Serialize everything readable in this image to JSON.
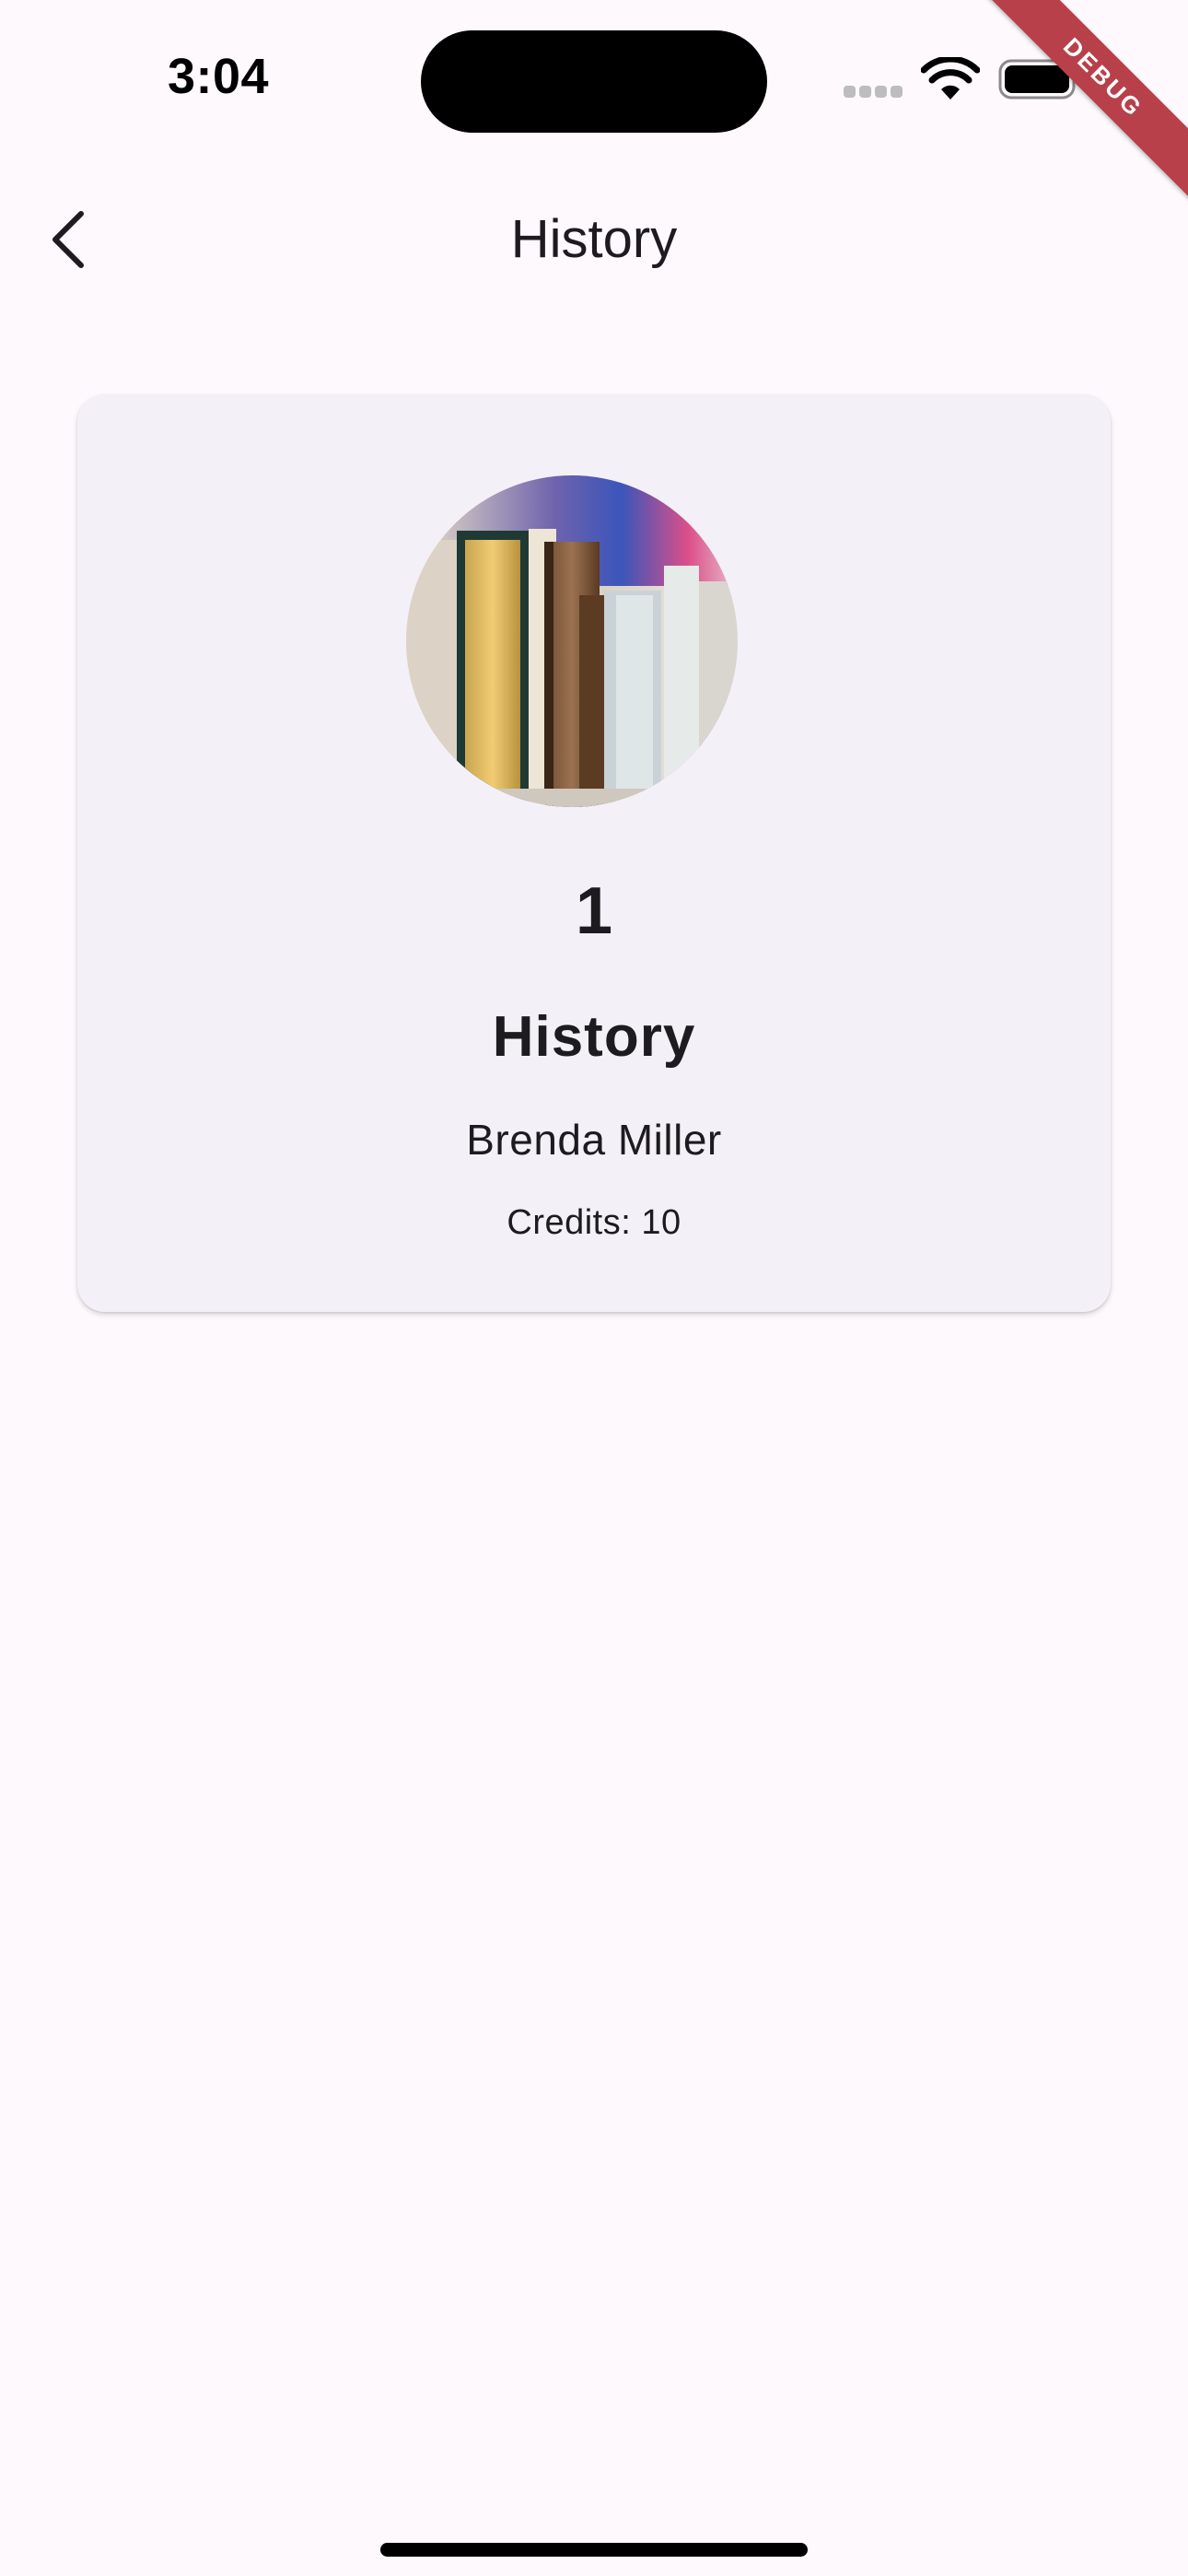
{
  "status_bar": {
    "time": "3:04",
    "icons": [
      "cellular-signal-icon",
      "wifi-icon",
      "battery-icon"
    ]
  },
  "debug_banner": {
    "label": "DEBUG",
    "color": "#B8404B"
  },
  "app_bar": {
    "back_icon": "chevron-left-icon",
    "title": "History"
  },
  "card": {
    "image": "books-on-shelf-photo",
    "number": "1",
    "title": "History",
    "author": "Brenda Miller",
    "credits": "Credits: 10",
    "background": "#F4F0F8"
  },
  "colors": {
    "page_background": "#FDF9FC",
    "text": "#1D1B20"
  }
}
